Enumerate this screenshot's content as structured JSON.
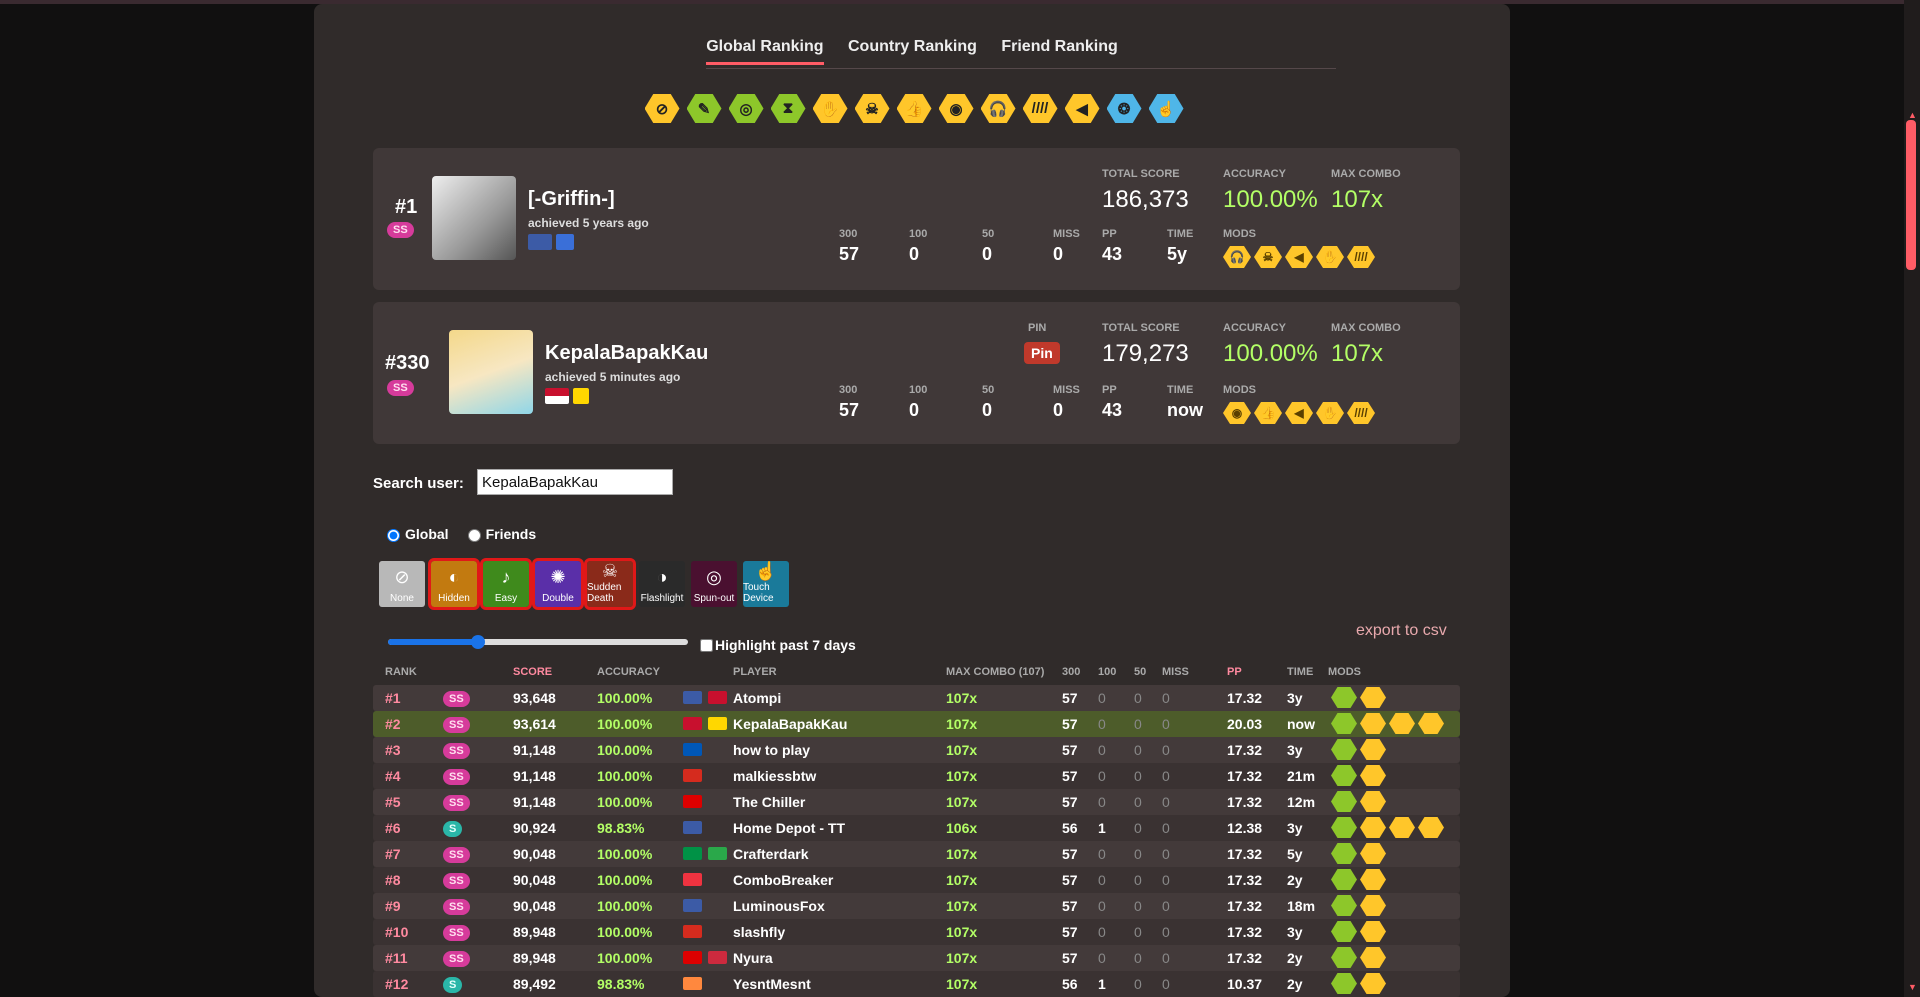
{
  "tabs": [
    {
      "label": "Global Ranking",
      "active": true
    },
    {
      "label": "Country Ranking",
      "active": false
    },
    {
      "label": "Friend Ranking",
      "active": false
    }
  ],
  "mod_icons": [
    {
      "name": "no-mod-icon",
      "color": "#ffc62a",
      "glyph": "⊘"
    },
    {
      "name": "easy-mod-icon",
      "color": "#8dc72a",
      "glyph": "✎"
    },
    {
      "name": "no-fail-mod-icon",
      "color": "#8dc72a",
      "glyph": "◎"
    },
    {
      "name": "half-time-mod-icon",
      "color": "#8dc72a",
      "glyph": "⧗"
    },
    {
      "name": "hard-rock-mod-icon",
      "color": "#ffc62a",
      "glyph": "✋"
    },
    {
      "name": "sudden-death-mod-icon",
      "color": "#ffc62a",
      "glyph": "☠"
    },
    {
      "name": "perfect-mod-icon",
      "color": "#ffc62a",
      "glyph": "👍"
    },
    {
      "name": "double-time-mod-icon",
      "color": "#ffc62a",
      "glyph": "◉"
    },
    {
      "name": "hidden-mod-icon",
      "color": "#ffc62a",
      "glyph": "🎧"
    },
    {
      "name": "flashlight-mod-icon",
      "color": "#ffc62a",
      "glyph": "////"
    },
    {
      "name": "nightcore-mod-icon",
      "color": "#ffc62a",
      "glyph": "◀"
    },
    {
      "name": "spun-out-mod-icon",
      "color": "#4fb6e8",
      "glyph": "❂"
    },
    {
      "name": "touch-device-mod-icon",
      "color": "#4fb6e8",
      "glyph": "☝"
    }
  ],
  "top_score": {
    "rank": "#1",
    "grade": "SS",
    "username": "[-Griffin-]",
    "achieved": "achieved 5 years ago",
    "labels": {
      "total_score": "TOTAL SCORE",
      "accuracy": "ACCURACY",
      "max_combo": "MAX COMBO",
      "c300": "300",
      "c100": "100",
      "c50": "50",
      "miss": "MISS",
      "pp": "PP",
      "time": "TIME",
      "mods": "MODS"
    },
    "total_score": "186,373",
    "accuracy": "100.00%",
    "max_combo": "107x",
    "c300": "57",
    "c100": "0",
    "c50": "0",
    "miss": "0",
    "pp": "43",
    "time": "5y",
    "mods": [
      "hidden",
      "sudden-death",
      "nightcore",
      "hard-rock",
      "flashlight"
    ]
  },
  "user_score": {
    "rank": "#330",
    "grade": "SS",
    "username": "KepalaBapakKau",
    "achieved": "achieved 5 minutes ago",
    "pin_label": "PIN",
    "pin_button": "Pin",
    "labels": {
      "total_score": "TOTAL SCORE",
      "accuracy": "ACCURACY",
      "max_combo": "MAX COMBO",
      "c300": "300",
      "c100": "100",
      "c50": "50",
      "miss": "MISS",
      "pp": "PP",
      "time": "TIME",
      "mods": "MODS"
    },
    "total_score": "179,273",
    "accuracy": "100.00%",
    "max_combo": "107x",
    "c300": "57",
    "c100": "0",
    "c50": "0",
    "miss": "0",
    "pp": "43",
    "time": "now",
    "mods": [
      "double-time",
      "perfect",
      "nightcore",
      "hard-rock",
      "flashlight"
    ]
  },
  "search": {
    "label": "Search user:",
    "value": "KepalaBapakKau"
  },
  "scope": {
    "global": "Global",
    "friends": "Friends",
    "selected": "global"
  },
  "mod_filter": [
    {
      "label": "None",
      "selected": false,
      "bg": "#b8b8b8",
      "glyph": "⊘"
    },
    {
      "label": "Hidden",
      "selected": true,
      "bg": "#c27a10",
      "glyph": "◐"
    },
    {
      "label": "Easy",
      "selected": true,
      "bg": "#3f8a1c",
      "glyph": "♪"
    },
    {
      "label": "Double",
      "selected": true,
      "bg": "#5a2fa8",
      "glyph": "✺"
    },
    {
      "label": "Sudden Death",
      "selected": true,
      "bg": "#8a2a1a",
      "glyph": "☠"
    },
    {
      "label": "Flashlight",
      "selected": false,
      "bg": "#2a2a2a",
      "glyph": "◑"
    },
    {
      "label": "Spun-out",
      "selected": false,
      "bg": "#4a1030",
      "glyph": "◎"
    },
    {
      "label": "Touch Device",
      "selected": false,
      "bg": "#1a7a9a",
      "glyph": "☝"
    }
  ],
  "slider_value": 0.3,
  "highlight_label": "Highlight past 7 days",
  "export_label": "export to csv",
  "table": {
    "headers": {
      "rank": "RANK",
      "score": "SCORE",
      "accuracy": "ACCURACY",
      "player": "PLAYER",
      "max_combo": "MAX COMBO (107)",
      "c300": "300",
      "c100": "100",
      "c50": "50",
      "miss": "MISS",
      "pp": "PP",
      "time": "TIME",
      "mods": "MODS"
    },
    "rows": [
      {
        "rank": "#1",
        "grade": "SS",
        "score": "93,648",
        "acc": "100.00%",
        "flags": [
          "#3c5ba6",
          "#c8102e"
        ],
        "player": "Atompi",
        "combo": "107x",
        "c300": "57",
        "c100": "0",
        "c50": "0",
        "miss": "0",
        "pp": "17.32",
        "time": "3y",
        "mods": [
          "green",
          "yellow"
        ]
      },
      {
        "rank": "#2",
        "grade": "SS",
        "score": "93,614",
        "acc": "100.00%",
        "flags": [
          "#c8102e",
          "#ffd700"
        ],
        "player": "KepalaBapakKau",
        "combo": "107x",
        "c300": "57",
        "c100": "0",
        "c50": "0",
        "miss": "0",
        "pp": "20.03",
        "time": "now",
        "mods": [
          "green",
          "yellow",
          "yellow",
          "yellow"
        ],
        "highlight": true
      },
      {
        "rank": "#3",
        "grade": "SS",
        "score": "91,148",
        "acc": "100.00%",
        "flags": [
          "#0057b7"
        ],
        "player": "how to play",
        "combo": "107x",
        "c300": "57",
        "c100": "0",
        "c50": "0",
        "miss": "0",
        "pp": "17.32",
        "time": "3y",
        "mods": [
          "green",
          "yellow"
        ]
      },
      {
        "rank": "#4",
        "grade": "SS",
        "score": "91,148",
        "acc": "100.00%",
        "flags": [
          "#d52b1e"
        ],
        "player": "malkiessbtw",
        "combo": "107x",
        "c300": "57",
        "c100": "0",
        "c50": "0",
        "miss": "0",
        "pp": "17.32",
        "time": "21m",
        "mods": [
          "green",
          "yellow"
        ]
      },
      {
        "rank": "#5",
        "grade": "SS",
        "score": "91,148",
        "acc": "100.00%",
        "flags": [
          "#dd0000"
        ],
        "player": "The Chiller",
        "combo": "107x",
        "c300": "57",
        "c100": "0",
        "c50": "0",
        "miss": "0",
        "pp": "17.32",
        "time": "12m",
        "mods": [
          "green",
          "yellow"
        ]
      },
      {
        "rank": "#6",
        "grade": "S",
        "score": "90,924",
        "acc": "98.83%",
        "flags": [
          "#3c5ba6"
        ],
        "player": "Home Depot - TT",
        "combo": "106x",
        "c300": "56",
        "c100": "1",
        "c50": "0",
        "miss": "0",
        "pp": "12.38",
        "time": "3y",
        "mods": [
          "green",
          "yellow",
          "yellow",
          "yellow"
        ]
      },
      {
        "rank": "#7",
        "grade": "SS",
        "score": "90,048",
        "acc": "100.00%",
        "flags": [
          "#009246",
          "#2aa84a"
        ],
        "player": "Crafterdark",
        "combo": "107x",
        "c300": "57",
        "c100": "0",
        "c50": "0",
        "miss": "0",
        "pp": "17.32",
        "time": "5y",
        "mods": [
          "green",
          "yellow"
        ]
      },
      {
        "rank": "#8",
        "grade": "SS",
        "score": "90,048",
        "acc": "100.00%",
        "flags": [
          "#ef3340"
        ],
        "player": "ComboBreaker",
        "combo": "107x",
        "c300": "57",
        "c100": "0",
        "c50": "0",
        "miss": "0",
        "pp": "17.32",
        "time": "2y",
        "mods": [
          "green",
          "yellow"
        ]
      },
      {
        "rank": "#9",
        "grade": "SS",
        "score": "90,048",
        "acc": "100.00%",
        "flags": [
          "#3c5ba6"
        ],
        "player": "LuminousFox",
        "combo": "107x",
        "c300": "57",
        "c100": "0",
        "c50": "0",
        "miss": "0",
        "pp": "17.32",
        "time": "18m",
        "mods": [
          "green",
          "yellow"
        ]
      },
      {
        "rank": "#10",
        "grade": "SS",
        "score": "89,948",
        "acc": "100.00%",
        "flags": [
          "#d52b1e"
        ],
        "player": "slashfly",
        "combo": "107x",
        "c300": "57",
        "c100": "0",
        "c50": "0",
        "miss": "0",
        "pp": "17.32",
        "time": "3y",
        "mods": [
          "green",
          "yellow"
        ]
      },
      {
        "rank": "#11",
        "grade": "SS",
        "score": "89,948",
        "acc": "100.00%",
        "flags": [
          "#dd0000",
          "#cd2a3e"
        ],
        "player": "Nyura",
        "combo": "107x",
        "c300": "57",
        "c100": "0",
        "c50": "0",
        "miss": "0",
        "pp": "17.32",
        "time": "2y",
        "mods": [
          "green",
          "yellow"
        ]
      },
      {
        "rank": "#12",
        "grade": "S",
        "score": "89,492",
        "acc": "98.83%",
        "flags": [
          "#ff883e"
        ],
        "player": "YesntMesnt",
        "combo": "107x",
        "c300": "56",
        "c100": "1",
        "c50": "0",
        "miss": "0",
        "pp": "10.37",
        "time": "2y",
        "mods": [
          "green",
          "yellow"
        ]
      }
    ]
  }
}
